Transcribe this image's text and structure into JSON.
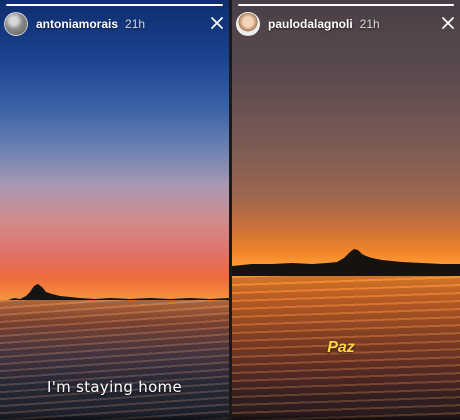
{
  "stories": [
    {
      "username": "antoniamorais",
      "time": "21h",
      "caption": "I'm staying home",
      "progress": 1.0,
      "avatar_icon": "profile-avatar-icon",
      "close_icon": "close-icon"
    },
    {
      "username": "paulodalagnoli",
      "time": "21h",
      "caption": "Paz",
      "progress": 1.0,
      "avatar_icon": "profile-avatar-icon",
      "close_icon": "close-icon"
    }
  ],
  "colors": {
    "caption_left": "#ffffff",
    "caption_right": "#ffd84a",
    "text": "#ffffff"
  }
}
